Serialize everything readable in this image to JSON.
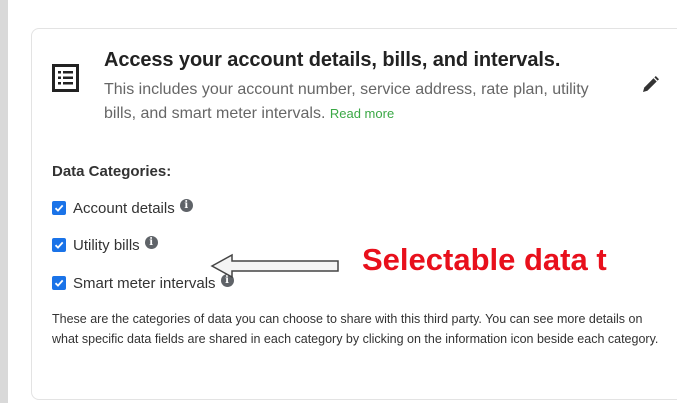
{
  "card": {
    "title": "Access your account details, bills, and intervals.",
    "description": "This includes your account number, service address, rate plan, utility bills, and smart meter intervals.",
    "read_more": "Read more",
    "icon": "document-list-icon",
    "edit_icon": "pencil-icon"
  },
  "categories": {
    "heading": "Data Categories:",
    "items": [
      {
        "label": "Account details",
        "checked": true
      },
      {
        "label": "Utility bills",
        "checked": true
      },
      {
        "label": "Smart meter intervals",
        "checked": true
      }
    ],
    "info_glyph": "i",
    "footer": "These are the categories of data you can choose to share with this third party. You can see more details on what specific data fields are shared in each category by clicking on the information icon beside each category."
  },
  "annotation": {
    "text": "Selectable data t",
    "color": "#e8101c"
  },
  "colors": {
    "checkbox": "#1a73e8",
    "link": "#3aa845"
  }
}
